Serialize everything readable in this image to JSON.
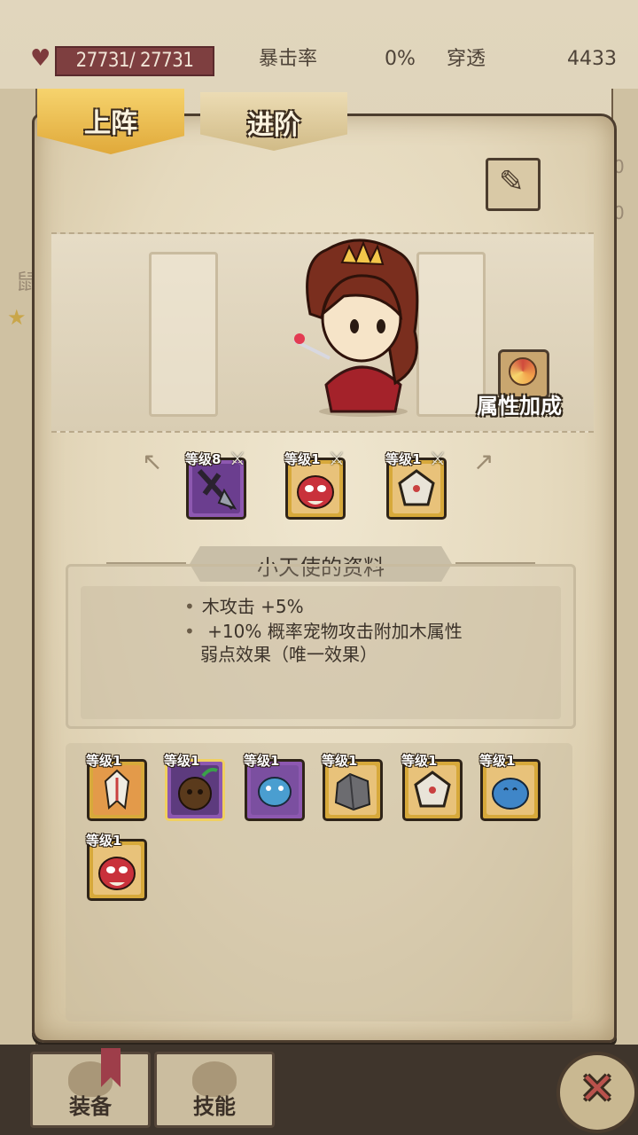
{
  "stats": {
    "hp": "27731/ 27731",
    "crit_label": "暴击率",
    "crit_value": "0%",
    "pierce_label": "穿透",
    "pierce_value": "4433"
  },
  "tabs": [
    {
      "label": "上阵",
      "active": true
    },
    {
      "label": "进阶",
      "active": false
    }
  ],
  "hero": {
    "attr_bonus_label": "属性加成"
  },
  "equipped": [
    {
      "level": "等级8",
      "frame": "purple",
      "icon": "dark-sword-icon"
    },
    {
      "level": "等级1",
      "frame": "gold",
      "icon": "red-bird-icon"
    },
    {
      "level": "等级1",
      "frame": "gold",
      "icon": "white-pentagon-icon"
    }
  ],
  "info": {
    "title": "小天使的资料",
    "line1": "木攻击  +5%",
    "line2": " +10% 概率宠物攻击附加木属性",
    "line3": "弱点效果（唯一效果）"
  },
  "pets": [
    {
      "level": "等级1",
      "frame": "gold",
      "icon": "white-crest-icon"
    },
    {
      "level": "等级1",
      "frame": "purple",
      "icon": "dark-seed-icon"
    },
    {
      "level": "等级1",
      "frame": "purple",
      "icon": "blue-dragon-icon"
    },
    {
      "level": "等级1",
      "frame": "gold",
      "icon": "stone-golem-icon"
    },
    {
      "level": "等级1",
      "frame": "gold",
      "icon": "white-pentagon-icon"
    },
    {
      "level": "等级1",
      "frame": "gold",
      "icon": "blue-dino-icon"
    },
    {
      "level": "等级1",
      "frame": "gold",
      "icon": "red-bird-icon"
    }
  ],
  "bottom": {
    "equip_label": "装备",
    "skill_label": "技能",
    "close_symbol": "✕"
  }
}
